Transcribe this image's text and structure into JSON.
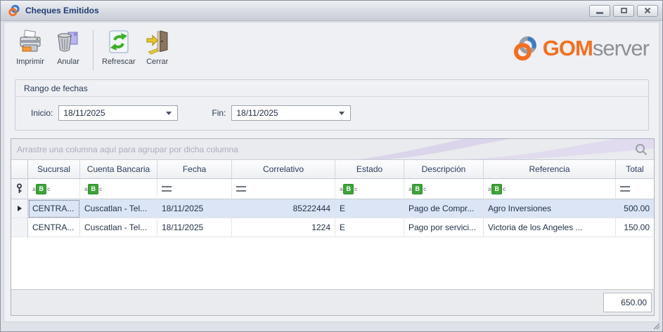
{
  "window": {
    "title": "Cheques Emitidos"
  },
  "toolbar": {
    "buttons": [
      {
        "label": "Imprimir"
      },
      {
        "label": "Anular"
      },
      {
        "label": "Refrescar"
      },
      {
        "label": "Cerrar"
      }
    ],
    "brand": {
      "gom": "GOM",
      "server": "server"
    }
  },
  "date_range": {
    "title": "Rango de fechas",
    "inicio": {
      "label": "Inicio:",
      "value": "18/11/2025"
    },
    "fin": {
      "label": "Fin:",
      "value": "18/11/2025"
    }
  },
  "grid": {
    "group_panel_text": "Arrastre una columna aquí para agrupar por dicha columna",
    "columns": [
      {
        "label": "Sucursal",
        "filter": "contains"
      },
      {
        "label": "Cuenta Bancaria",
        "filter": "contains"
      },
      {
        "label": "Fecha",
        "filter": "equals"
      },
      {
        "label": "Correlativo",
        "filter": "equals"
      },
      {
        "label": "Estado",
        "filter": "contains"
      },
      {
        "label": "Descripción",
        "filter": "contains"
      },
      {
        "label": "Referencia",
        "filter": "contains"
      },
      {
        "label": "Total",
        "filter": "equals"
      }
    ],
    "rows": [
      {
        "sucursal": "CENTRA...",
        "cuenta_bancaria": "Cuscatlan - Tel...",
        "fecha": "18/11/2025",
        "correlativo": "85222444",
        "estado": "E",
        "descripcion": "Pago de Compr...",
        "referencia": "Agro Inversiones",
        "total": "500.00"
      },
      {
        "sucursal": "CENTRA...",
        "cuenta_bancaria": "Cuscatlan - Tel...",
        "fecha": "18/11/2025",
        "correlativo": "1224",
        "estado": "E",
        "descripcion": "Pago por servici...",
        "referencia": "Victoria de los Angeles ...",
        "total": "150.00"
      }
    ],
    "summary_total": "650.00"
  },
  "icons": {
    "abc": {
      "a": "a",
      "b": "B",
      "c": "c"
    }
  },
  "colors": {
    "brand_orange": "#f26f21",
    "brand_gray": "#8d9094",
    "title_text": "#1f3c73",
    "selected_row": "#dbe5f5",
    "filter_green": "#3fa33a"
  }
}
